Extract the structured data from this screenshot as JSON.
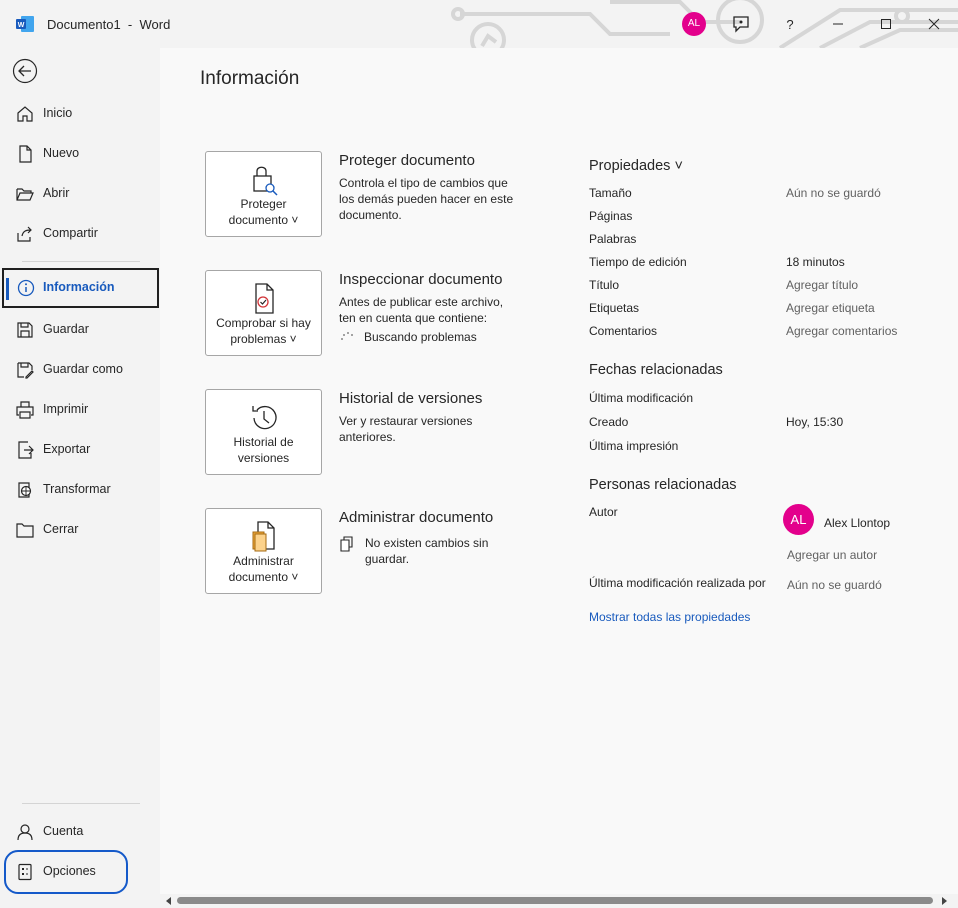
{
  "window": {
    "title": "Documento1  -  Word",
    "avatar_initials": "AL",
    "help_label": "?",
    "accent": "#185abd",
    "avatar_color": "#e3008c"
  },
  "sidebar": {
    "items": [
      {
        "label": "Inicio",
        "icon": "home-icon"
      },
      {
        "label": "Nuevo",
        "icon": "new-document-icon"
      },
      {
        "label": "Abrir",
        "icon": "folder-open-icon"
      },
      {
        "label": "Compartir",
        "icon": "share-icon"
      },
      {
        "label": "Información",
        "icon": "info-icon",
        "active": true
      },
      {
        "label": "Guardar",
        "icon": "save-icon"
      },
      {
        "label": "Guardar como",
        "icon": "save-as-icon"
      },
      {
        "label": "Imprimir",
        "icon": "print-icon"
      },
      {
        "label": "Exportar",
        "icon": "export-icon"
      },
      {
        "label": "Transformar",
        "icon": "transform-icon"
      },
      {
        "label": "Cerrar",
        "icon": "close-folder-icon"
      }
    ],
    "bottom": [
      {
        "label": "Cuenta",
        "icon": "account-icon"
      },
      {
        "label": "Opciones",
        "icon": "options-icon"
      }
    ]
  },
  "main": {
    "title": "Información",
    "sections": [
      {
        "button": "Proteger\ndocumento ˅",
        "title": "Proteger documento",
        "desc": "Controla el tipo de cambios que los demás pueden hacer en este documento."
      },
      {
        "button": "Comprobar si hay problemas ˅",
        "title": "Inspeccionar documento",
        "desc": "Antes de publicar este archivo, ten en cuenta que contiene:",
        "status": "Buscando problemas"
      },
      {
        "button": "Historial de versiones",
        "title": "Historial de versiones",
        "desc": "Ver y restaurar versiones anteriores."
      },
      {
        "button": "Administrar documento ˅",
        "title": "Administrar documento",
        "status": "No existen cambios sin guardar."
      }
    ]
  },
  "properties": {
    "heading": "Propiedades ˅",
    "rows": [
      {
        "label": "Tamaño",
        "value": "Aún no se guardó"
      },
      {
        "label": "Páginas",
        "value": ""
      },
      {
        "label": "Palabras",
        "value": ""
      },
      {
        "label": "Tiempo de edición",
        "value": "18 minutos"
      },
      {
        "label": "Título",
        "value": "Agregar título"
      },
      {
        "label": "Etiquetas",
        "value": "Agregar etiqueta"
      },
      {
        "label": "Comentarios",
        "value": "Agregar comentarios"
      }
    ],
    "dates_heading": "Fechas relacionadas",
    "dates": [
      {
        "label": "Última modificación",
        "value": ""
      },
      {
        "label": "Creado",
        "value": "Hoy, 15:30"
      },
      {
        "label": "Última impresión",
        "value": ""
      }
    ],
    "people_heading": "Personas relacionadas",
    "author_label": "Autor",
    "author_initials": "AL",
    "author_name": "Alex Llontop",
    "add_author": "Agregar un autor",
    "last_modified_by_label": "Última modificación realizada por",
    "last_modified_by_value": "Aún no se guardó",
    "show_all": "Mostrar todas las propiedades"
  }
}
